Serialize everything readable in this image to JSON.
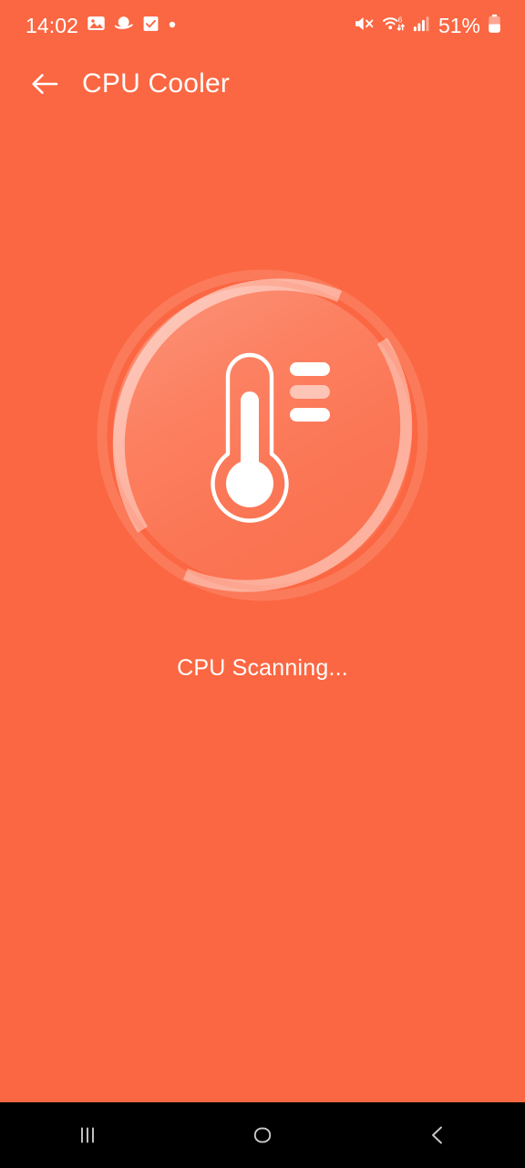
{
  "theme": {
    "background": "#FB6742",
    "accent": "#FFFFFF",
    "nav_background": "#000000",
    "nav_icon": "#C9C9C9"
  },
  "status_bar": {
    "clock": "14:02",
    "battery_percent": "51%",
    "left_icons": [
      {
        "name": "photo-icon"
      },
      {
        "name": "planet-icon"
      },
      {
        "name": "checkbox-icon"
      },
      {
        "name": "dot-icon"
      }
    ],
    "right_icons": [
      {
        "name": "mute-icon"
      },
      {
        "name": "wifi-6-icon",
        "label": "6"
      },
      {
        "name": "cellular-signal-icon"
      },
      {
        "name": "battery-icon"
      }
    ]
  },
  "app_bar": {
    "back_label": "Back",
    "title": "CPU Cooler"
  },
  "scan": {
    "status_text": "CPU Scanning...",
    "icon_name": "thermometer-icon",
    "ring_name": "scan-progress-ring",
    "dash_count": 3
  },
  "nav_bar": {
    "buttons": [
      {
        "name": "recents-button",
        "label": "Recents"
      },
      {
        "name": "home-button",
        "label": "Home"
      },
      {
        "name": "back-button",
        "label": "Back"
      }
    ]
  }
}
